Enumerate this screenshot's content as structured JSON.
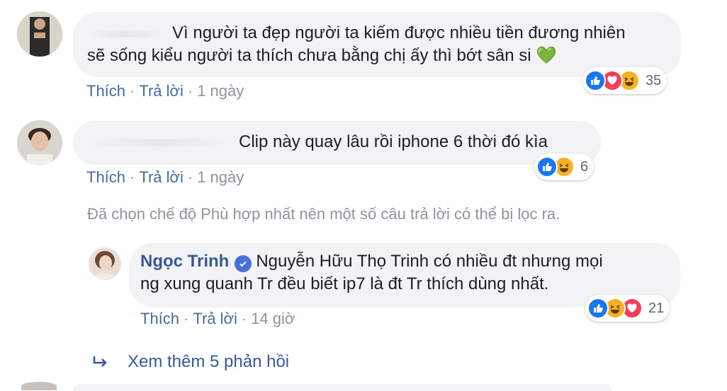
{
  "comments": [
    {
      "text_line1": "Vì người ta đẹp người ta kiếm được nhiều tiền đương nhiên",
      "text_line2": "sẽ sống kiểu người ta thích chưa bằng chị ấy thì bớt sân si",
      "emoji": "💚",
      "like_label": "Thích",
      "reply_label": "Trả lời",
      "time": "1 ngày",
      "reaction_icons": [
        "like-icon",
        "love-icon",
        "haha-icon"
      ],
      "reaction_count": "35"
    },
    {
      "text": "Clip này quay lâu rồi iphone 6 thời đó kìa",
      "like_label": "Thích",
      "reply_label": "Trả lời",
      "time": "1 ngày",
      "reaction_icons": [
        "like-icon",
        "haha-icon"
      ],
      "reaction_count": "6"
    }
  ],
  "filter_notice": "Đã chọn chế độ Phù hợp nhất nên một số câu trả lời có thể bị lọc ra.",
  "reply": {
    "author": "Ngọc Trinh",
    "text_line1": "Nguyễn Hữu Thọ Trinh có nhiều đt nhưng mọi",
    "text_line2": "ng xung quanh Tr đều biết ip7 là đt Tr thích dùng nhất.",
    "like_label": "Thích",
    "reply_label": "Trả lời",
    "time": "14 giờ",
    "reaction_icons": [
      "like-icon",
      "haha-icon",
      "love-icon"
    ],
    "reaction_count": "21"
  },
  "view_more": "Xem thêm 5 phản hồi",
  "colors": {
    "link": "#4b67a1",
    "meta": "#8d949e",
    "bubble": "#f2f3f5",
    "like": "#1877f2",
    "love": "#f33e58",
    "haha": "#f7b125",
    "verified": "#4b6fd8"
  }
}
